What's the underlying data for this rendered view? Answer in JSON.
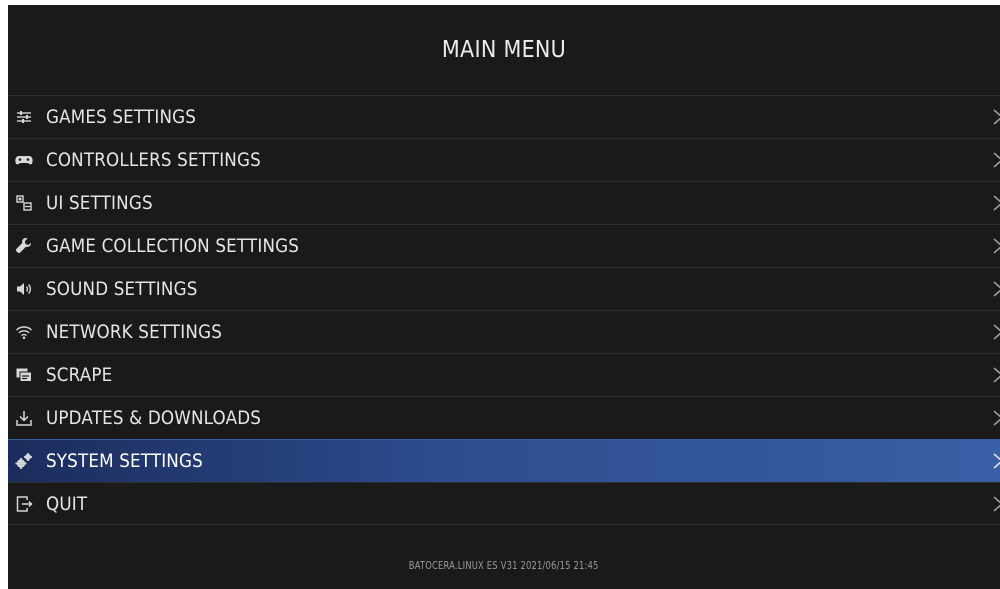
{
  "header": {
    "title": "MAIN MENU"
  },
  "menu": {
    "items": [
      {
        "label": "GAMES SETTINGS",
        "icon": "sliders-icon"
      },
      {
        "label": "CONTROLLERS SETTINGS",
        "icon": "gamepad-icon"
      },
      {
        "label": "UI SETTINGS",
        "icon": "ui-icon"
      },
      {
        "label": "GAME COLLECTION SETTINGS",
        "icon": "wrench-icon"
      },
      {
        "label": "SOUND SETTINGS",
        "icon": "speaker-icon"
      },
      {
        "label": "NETWORK SETTINGS",
        "icon": "wifi-icon"
      },
      {
        "label": "SCRAPE",
        "icon": "scrape-icon"
      },
      {
        "label": "UPDATES & DOWNLOADS",
        "icon": "download-icon"
      },
      {
        "label": "SYSTEM SETTINGS",
        "icon": "gears-icon",
        "selected": true
      },
      {
        "label": "QUIT",
        "icon": "exit-icon"
      }
    ],
    "selected_index": 8
  },
  "footer": {
    "version": "BATOCERA.LINUX ES V31 2021/06/15 21:45"
  },
  "colors": {
    "background": "#1a1a1a",
    "text": "#e6e6e6",
    "selection_start": "#1c2c5c",
    "selection_end": "#3a5fa6",
    "divider": "#2e2e2e"
  }
}
